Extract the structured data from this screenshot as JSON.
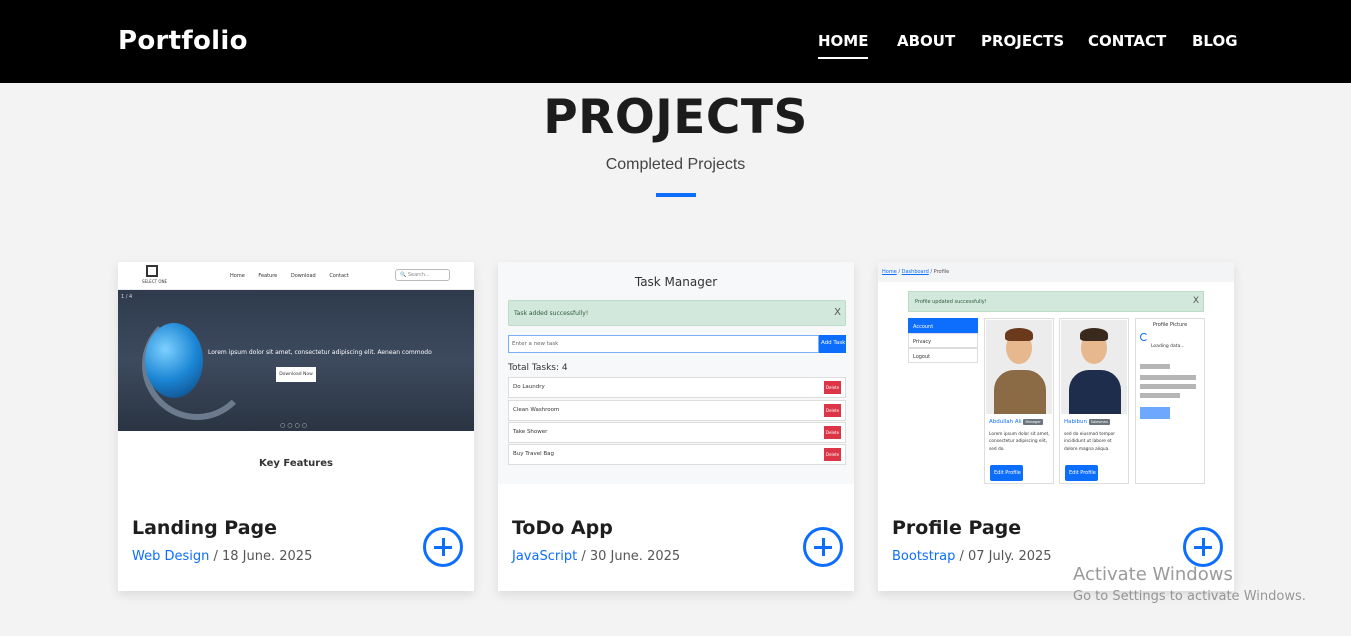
{
  "navbar": {
    "brand": "Portfolio",
    "links": [
      "HOME",
      "ABOUT",
      "PROJECTS",
      "CONTACT",
      "BLOG"
    ],
    "active": "HOME"
  },
  "section": {
    "title": "PROJECTS",
    "subtitle": "Completed Projects"
  },
  "projects": [
    {
      "title": "Landing Page",
      "category": "Web Design",
      "date": "/ 18 June. 2025",
      "thumb": {
        "nav_links": [
          "Home",
          "Feature",
          "Download",
          "Contact"
        ],
        "search_placeholder": "Search...",
        "logo_text": "SELECT ONE",
        "hero_text": "Lorem ipsum dolor sit amet, consectetur adipiscing elit. Aenean commodo",
        "hero_button": "Download Now",
        "slide_counter": "1 / 4",
        "dots": "○○○○",
        "section_heading": "Key Features"
      }
    },
    {
      "title": "ToDo App",
      "category": "JavaScript",
      "date": "/ 30 June. 2025",
      "thumb": {
        "title": "Task Manager",
        "alert": "Task added successfully!",
        "alert_close": "X",
        "input_placeholder": "Enter a new task",
        "add_button": "Add Task",
        "total": "Total Tasks: 4",
        "tasks": [
          "Do Laundry",
          "Clean Washroom",
          "Take Shower",
          "Buy Travel Bag"
        ],
        "delete_label": "Delete"
      }
    },
    {
      "title": "Profile Page",
      "category": "Bootstrap",
      "date": "/ 07 July. 2025",
      "thumb": {
        "breadcrumb_home": "Home",
        "breadcrumb_dash": "Dashboard",
        "breadcrumb_current": "/ Profile",
        "alert": "Profile updated successfully!",
        "alert_close": "X",
        "menu": [
          "Account",
          "Privacy",
          "Logout"
        ],
        "users": [
          {
            "name": "Abdullah Ali",
            "badge": "Manager",
            "desc": "Lorem ipsum dolor sit amet, consectetur adipiscing elit, sed do."
          },
          {
            "name": "Habibun",
            "badge": "Salesman",
            "desc": "sed do eiusmod tempor incididunt ut labore et dolore magna aliqua."
          }
        ],
        "edit_label": "Edit Profile",
        "picture_title": "Profile Picture",
        "loading": "Loading data..."
      }
    }
  ],
  "watermark": {
    "line1": "Activate Windows",
    "line2": "Go to Settings to activate Windows."
  },
  "colors": {
    "accent": "#0d6efd",
    "navbar_bg": "#000000",
    "page_bg": "#f3f3f3"
  },
  "icons": {
    "card_action": "plus-circle-icon"
  }
}
